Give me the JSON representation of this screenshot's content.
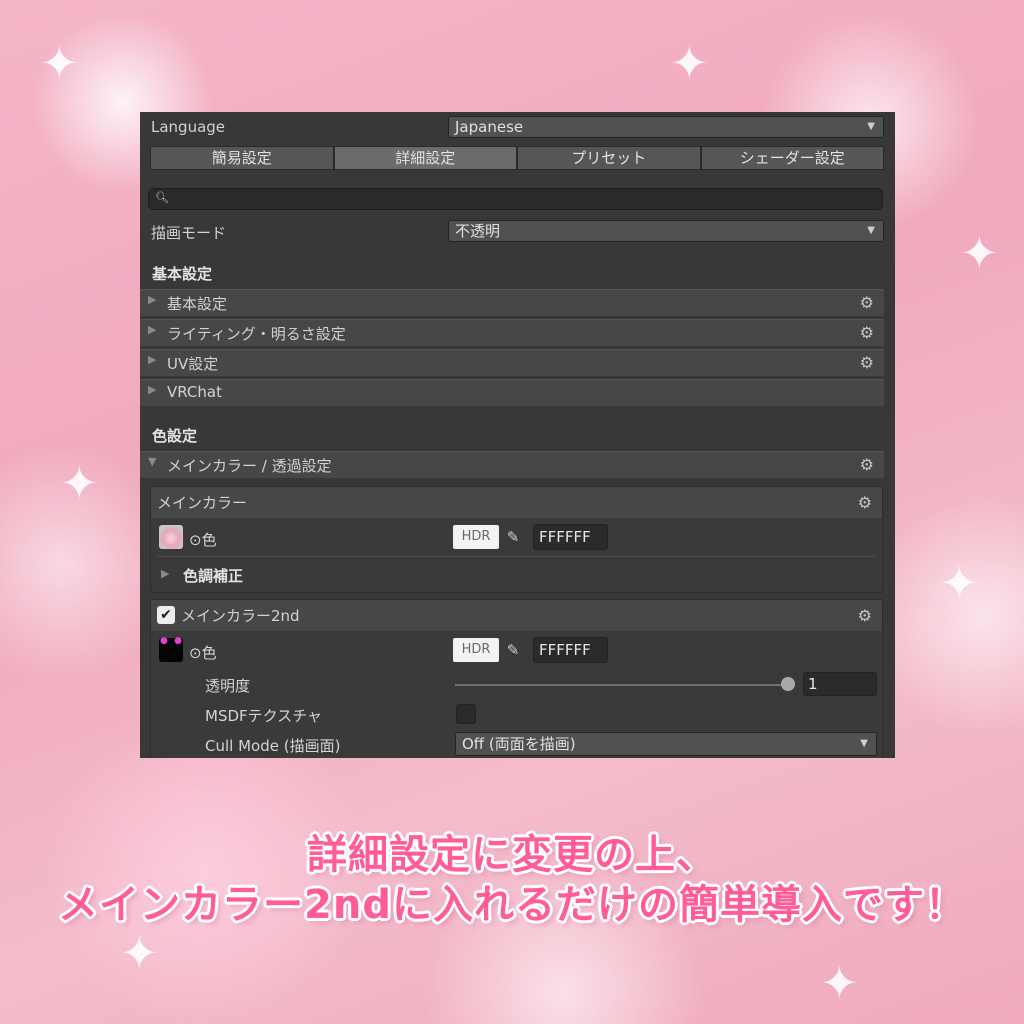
{
  "language": {
    "label": "Language",
    "value": "Japanese"
  },
  "tabs": [
    {
      "label": "簡易設定",
      "active": false
    },
    {
      "label": "詳細設定",
      "active": true
    },
    {
      "label": "プリセット",
      "active": false
    },
    {
      "label": "シェーダー設定",
      "active": false
    }
  ],
  "render_mode": {
    "label": "描画モード",
    "value": "不透明"
  },
  "basic_settings": {
    "heading": "基本設定",
    "sections": [
      "基本設定",
      "ライティング・明るさ設定",
      "UV設定",
      "VRChat"
    ]
  },
  "color_settings": {
    "heading": "色設定",
    "main_section": "メインカラー / 透過設定",
    "main_color": {
      "title": "メインカラー",
      "color_label": "⊙色",
      "hdr": "HDR",
      "hex": "FFFFFF",
      "tone_correction": "色調補正"
    },
    "main_color_2nd": {
      "title": "メインカラー2nd",
      "checked": true,
      "color_label": "⊙色",
      "hdr": "HDR",
      "hex": "FFFFFF",
      "opacity_label": "透明度",
      "opacity_value": "1",
      "msdf_label": "MSDFテクスチャ",
      "cull_label": "Cull Mode (描画面)",
      "cull_value": "Off (両面を描画)"
    }
  },
  "caption": {
    "line1": "詳細設定に変更の上、",
    "line2": "メインカラー2ndに入れるだけの簡単導入です！"
  },
  "colors": {
    "panel_bg": "#383838",
    "caption_pink": "#ff5c98",
    "background_pink": "#f5b6c8"
  }
}
